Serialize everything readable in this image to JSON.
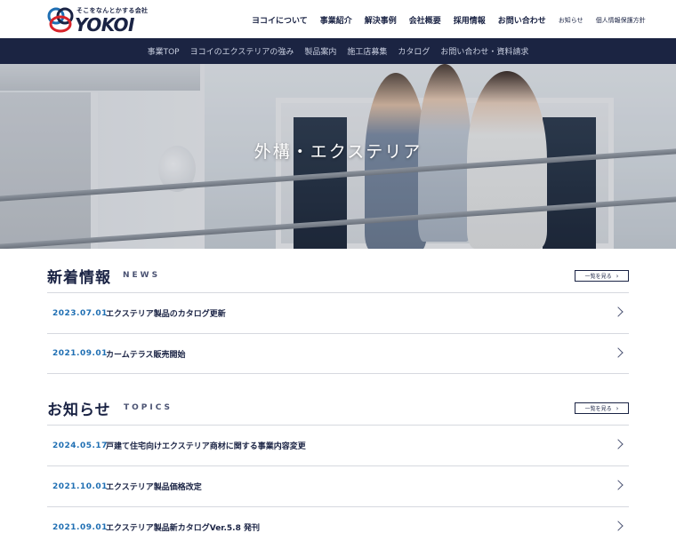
{
  "header": {
    "logo_tagline": "そこをなんとかする会社",
    "logo_wordmark": "YOKOI",
    "nav": [
      {
        "label": "ヨコイについて"
      },
      {
        "label": "事業紹介"
      },
      {
        "label": "解決事例"
      },
      {
        "label": "会社概要"
      },
      {
        "label": "採用情報"
      },
      {
        "label": "お問い合わせ"
      },
      {
        "label": "お知らせ"
      },
      {
        "label": "個人情報保護方針"
      }
    ]
  },
  "subnav": [
    {
      "label": "事業TOP"
    },
    {
      "label": "ヨコイのエクステリアの強み"
    },
    {
      "label": "製品案内"
    },
    {
      "label": "施工店募集"
    },
    {
      "label": "カタログ"
    },
    {
      "label": "お問い合わせ・資料請求"
    }
  ],
  "hero": {
    "title": "外構・エクステリア"
  },
  "news": {
    "title_jp": "新着情報",
    "title_en": "NEWS",
    "more_label": "一覧を見る",
    "items": [
      {
        "date": "2023.07.01",
        "title": "エクステリア製品のカタログ更新"
      },
      {
        "date": "2021.09.01",
        "title": "カームテラス販売開始"
      }
    ]
  },
  "topics": {
    "title_jp": "お知らせ",
    "title_en": "TOPICS",
    "more_label": "一覧を見る",
    "items": [
      {
        "date": "2024.05.17",
        "title": "戸建て住宅向けエクステリア商材に関する事業内容変更"
      },
      {
        "date": "2021.10.01",
        "title": "エクステリア製品価格改定"
      },
      {
        "date": "2021.09.01",
        "title": "エクステリア製品新カタログVer.5.8 発刊"
      }
    ]
  },
  "colors": {
    "navy": "#1b2442",
    "date_blue": "#1f6fb3",
    "logo_red": "#d8232a",
    "logo_blue": "#1f6fb3"
  }
}
